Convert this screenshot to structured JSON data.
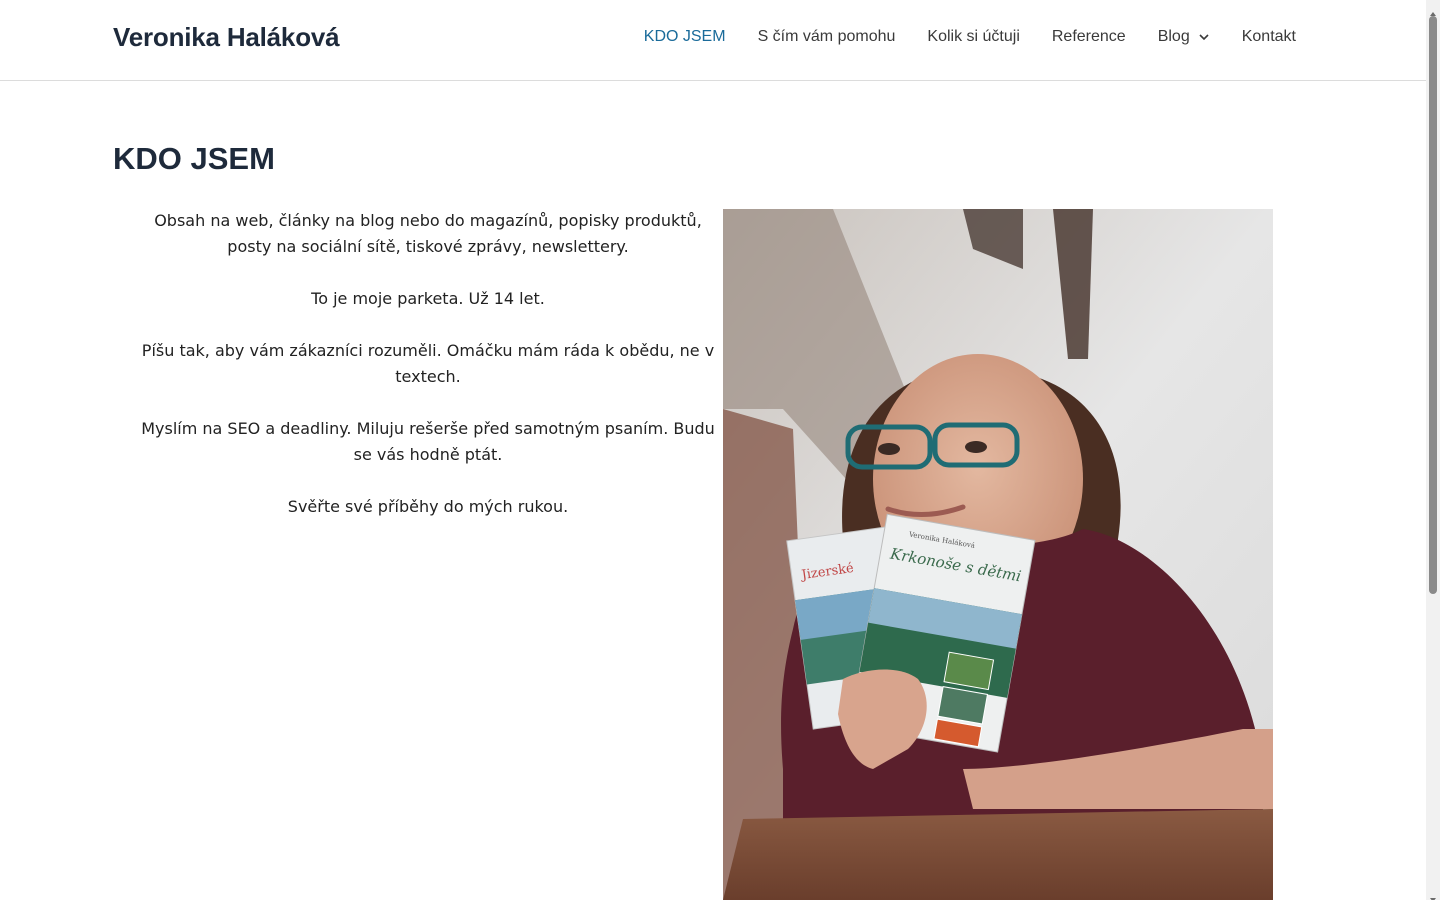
{
  "header": {
    "site_title": "Veronika Haláková",
    "nav": [
      {
        "label": "KDO JSEM",
        "active": true
      },
      {
        "label": "S čím vám pomohu"
      },
      {
        "label": "Kolik si účtuji"
      },
      {
        "label": "Reference"
      },
      {
        "label": "Blog",
        "has_dropdown": true,
        "icon": "chevron-down-icon"
      },
      {
        "label": "Kontakt"
      }
    ]
  },
  "main": {
    "title": "KDO JSEM",
    "paragraphs": [
      "Obsah na web, články na blog nebo do magazínů, popisky produktů, posty na sociální sítě, tiskové zprávy, newslettery.",
      "To je moje parketa. Už 14 let.",
      "Píšu tak, aby vám zákazníci rozuměli. Omáčku mám ráda k obědu, ne v textech.",
      "Myslím na SEO a deadliny. Miluju rešerše před samotným psaním. Budu se vás hodně ptát.",
      "Svěřte své příběhy do mých rukou."
    ],
    "photo": {
      "book_front_author": "Veronika Haláková",
      "book_front_title": "Krkonoše s dětmi",
      "book_back_title": "Jizerské"
    }
  },
  "colors": {
    "accent": "#1a6b9a",
    "heading": "#1e2a3b",
    "border": "#dcdcdc"
  }
}
